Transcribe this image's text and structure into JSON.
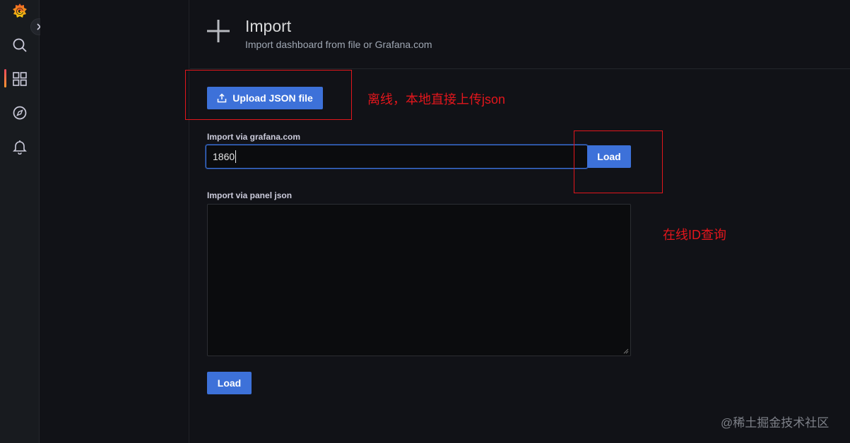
{
  "header": {
    "title": "Import",
    "subtitle": "Import dashboard from file or Grafana.com"
  },
  "sidebar": {
    "items": [
      {
        "icon": "grafana-logo-icon"
      },
      {
        "icon": "search-icon"
      },
      {
        "icon": "dashboards-icon",
        "active": true
      },
      {
        "icon": "explore-compass-icon"
      },
      {
        "icon": "alerting-bell-icon"
      }
    ],
    "expand_icon": "chevron-right-icon"
  },
  "main": {
    "upload_button_label": "Upload JSON file",
    "grafana_com_label": "Import via grafana.com",
    "grafana_com_value": "1860",
    "load_button_label": "Load",
    "panel_json_label": "Import via panel json",
    "panel_json_value": "",
    "load_button_2_label": "Load"
  },
  "annotations": {
    "offline_note": "离线，本地直接上传json",
    "online_note": "在线ID查询"
  },
  "watermark": "@稀土掘金技术社区",
  "colors": {
    "primary_button": "#3d71d9",
    "annotation_red": "#e3161c",
    "background": "#111217"
  }
}
